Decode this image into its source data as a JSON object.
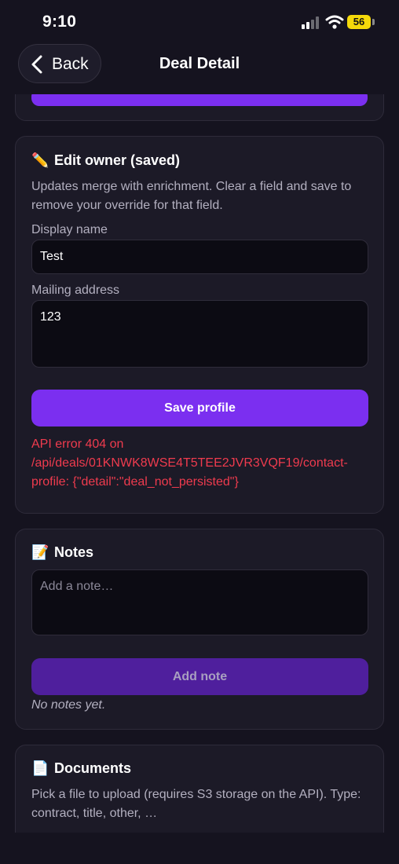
{
  "status_bar": {
    "time": "9:10",
    "battery": "56"
  },
  "nav": {
    "back_label": "Back",
    "title": "Deal Detail"
  },
  "edit_owner": {
    "emoji": "✏️",
    "title": "Edit owner (saved)",
    "description": "Updates merge with enrichment. Clear a field and save to remove your override for that field.",
    "display_name_label": "Display name",
    "display_name_value": "Test",
    "mailing_address_label": "Mailing address",
    "mailing_address_value": "123",
    "save_label": "Save profile",
    "error": "API error 404 on /api/deals/01KNWK8WSE4T5TEE2JVR3VQF19/contact-profile: {\"detail\":\"deal_not_persisted\"}"
  },
  "notes": {
    "emoji": "📝",
    "title": "Notes",
    "placeholder": "Add a note…",
    "add_label": "Add note",
    "empty_text": "No notes yet."
  },
  "documents": {
    "emoji": "📄",
    "title": "Documents",
    "description": "Pick a file to upload (requires S3 storage on the API). Type: contract, title, other, …"
  },
  "colors": {
    "accent": "#7b2ff0",
    "error": "#ef3b4e",
    "background": "#15131f",
    "card": "#1c1a27"
  }
}
